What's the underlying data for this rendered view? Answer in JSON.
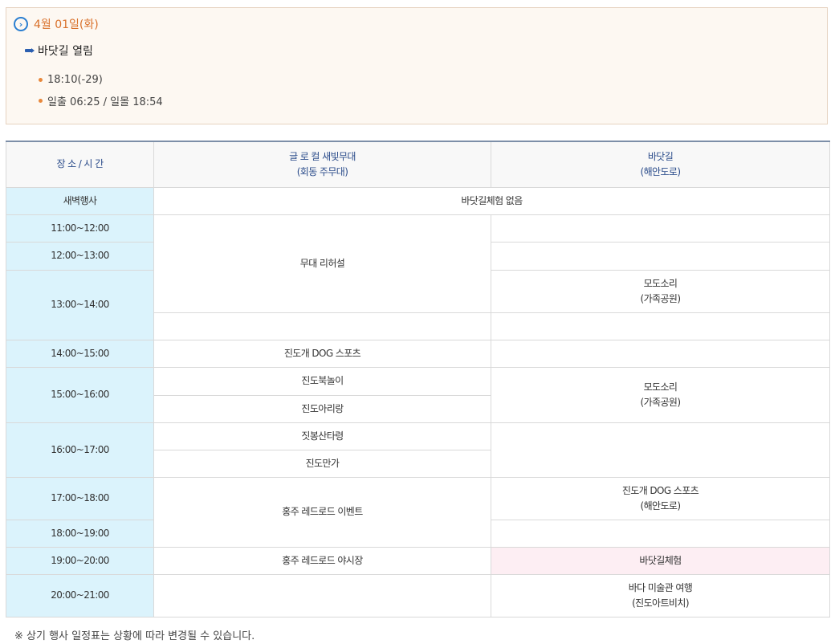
{
  "info": {
    "date": "4월 01일(화)",
    "title": "바닷길 열림",
    "tide_time": "18:10(-29)",
    "sun": "일출 06:25 / 일몰 18:54"
  },
  "table": {
    "headers": {
      "place_time": "장 소 / 시 간",
      "stage": [
        "글 로 컬 새빛무대",
        "(회동 주무대)"
      ],
      "sea_road": [
        "바닷길",
        "(해안도로)"
      ]
    },
    "times": [
      "새벽행사",
      "11:00~12:00",
      "12:00~13:00",
      "13:00~14:00",
      "14:00~15:00",
      "15:00~16:00",
      "16:00~17:00",
      "17:00~18:00",
      "18:00~19:00",
      "19:00~20:00",
      "20:00~21:00"
    ],
    "dawn_event": "바닷길체험 없음",
    "stage_events": {
      "rehearsal": "무대 리허설",
      "dog_sports": "진도개 DOG 스포츠",
      "bukdori": "진도북놀이",
      "arirang": "진도아리랑",
      "sitgim": "짓봉산타령",
      "manga": "진도만가",
      "hongju_event": "홍주 레드로드 이벤트",
      "hongju_market": "홍주 레드로드 야시장"
    },
    "sea_events": {
      "modosori1": [
        "모도소리",
        "(가족공원)"
      ],
      "modosori2": [
        "모도소리",
        "(가족공원)"
      ],
      "dog_sports_sea": [
        "진도개 DOG 스포츠",
        "(해안도로)"
      ],
      "sea_experience": "바닷길체험",
      "art_trip": [
        "바다 미술관 여행",
        "(진도아트비치)"
      ]
    }
  },
  "note": "※ 상기 행사 일정표는 상황에 따라 변경될 수 있습니다.",
  "colors": {
    "accent_orange": "#d9702a",
    "accent_blue": "#2b7fd1",
    "time_bg": "#dbf3fc",
    "highlight_pink": "#fdeef3",
    "header_text": "#2a4b8a"
  }
}
